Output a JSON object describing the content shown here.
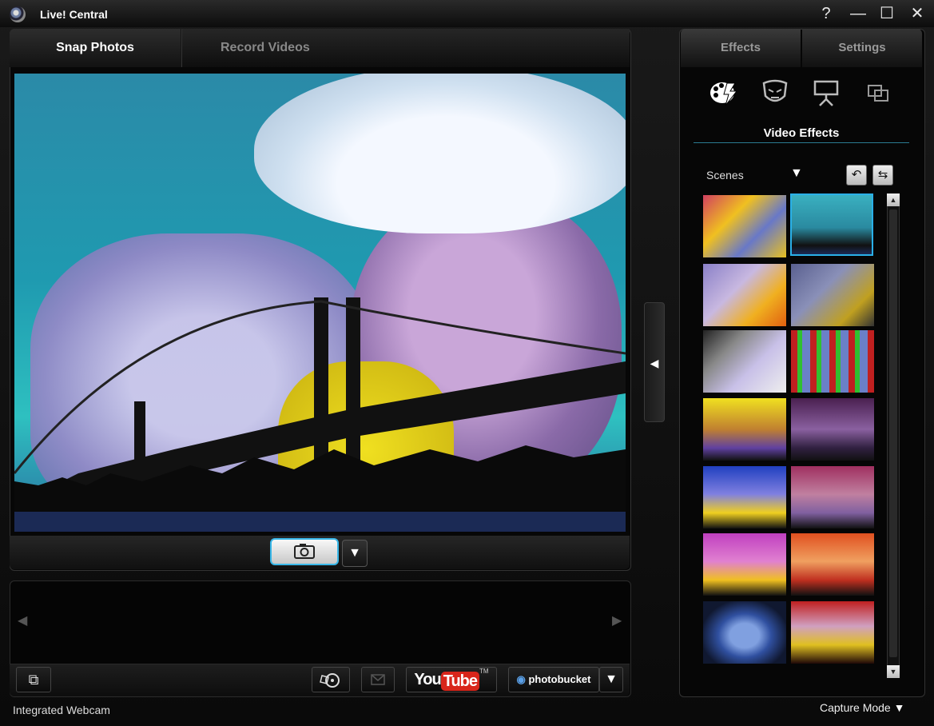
{
  "window": {
    "title": "Live! Central",
    "controls": {
      "help": "?",
      "minimize": "—",
      "maximize": "☐",
      "close": "✕"
    }
  },
  "main_tabs": [
    {
      "label": "Snap Photos",
      "active": true
    },
    {
      "label": "Record Videos",
      "active": false
    }
  ],
  "capture": {
    "snap_icon": "camera-icon",
    "dropdown_glyph": "▼"
  },
  "gallery": {
    "prev_glyph": "◀",
    "next_glyph": "▶",
    "buttons": {
      "share_glyph": "⧉",
      "youtube_text": "YouTube",
      "youtube_tm": "TM",
      "photobucket_text": "photobucket",
      "more_glyph": "▼"
    }
  },
  "side_handle_glyph": "◀",
  "right_tabs": [
    {
      "label": "Effects",
      "active": true
    },
    {
      "label": "Settings",
      "active": false
    }
  ],
  "effects": {
    "section_title": "Video Effects",
    "category_dropdown": {
      "value": "Scenes",
      "glyph": "▼"
    },
    "undo_glyph": "↶",
    "import_glyph": "⇆",
    "thumbnails_count_visible": 14,
    "selected_index": 1,
    "scroll_up": "▲",
    "scroll_down": "▼"
  },
  "status": {
    "device": "Integrated Webcam",
    "mode": "Capture Mode",
    "mode_glyph": "▼"
  },
  "colors": {
    "accent": "#2ab0e8",
    "youtube_red": "#d8261b"
  }
}
